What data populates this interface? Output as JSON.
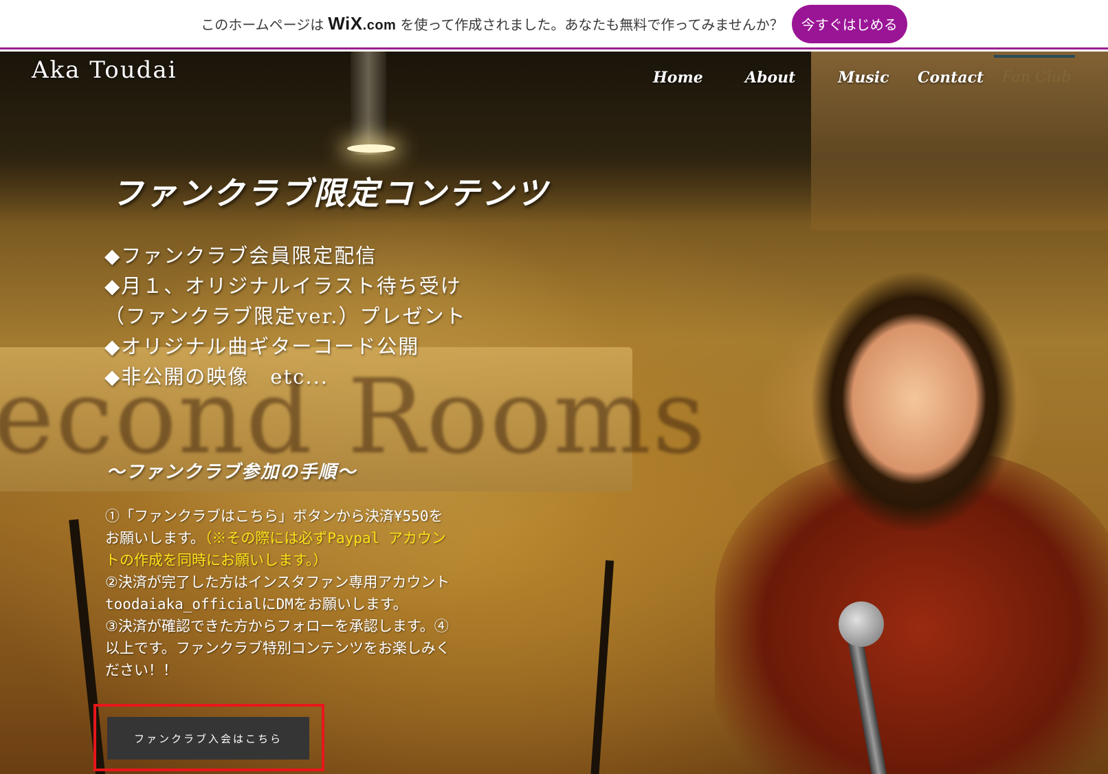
{
  "wix_banner": {
    "text_before": "このホームページは",
    "logo": "WiX",
    "logo_suffix": ".com",
    "text_after": "を使って作成されました。あなたも無料で作ってみませんか？",
    "cta_label": "今すぐはじめる",
    "accent_color": "#9a1596"
  },
  "site": {
    "title": "Aka Toudai"
  },
  "nav": {
    "items": [
      {
        "label": "Home"
      },
      {
        "label": "About"
      },
      {
        "label": "Music"
      },
      {
        "label": "Contact"
      },
      {
        "label": "Fan Club",
        "active": true
      }
    ]
  },
  "main": {
    "heading": "ファンクラブ限定コンテンツ",
    "features": [
      "◆ファンクラブ会員限定配信",
      "◆月１、オリジナルイラスト待ち受け",
      "（ファンクラブ限定ver.）プレゼント",
      "◆オリジナル曲ギターコード公開",
      "◆非公開の映像　etc..."
    ],
    "background_sign": "econd Rooms",
    "steps_heading": "～ファンクラブ参加の手順～",
    "steps": {
      "part1": "①「ファンクラブはこちら」ボタンから決済¥550をお願いします。",
      "part1_note": "（※その際には必ずPaypal アカウントの作成を同時にお願いします。）",
      "part2": "②決済が完了した方はインスタファン専用アカウントtoodaiaka_officialにDMをお願いします。",
      "part3": "③決済が確認できた方からフォローを承認します。④以上です。ファンクラブ特別コンテンツをお楽しみください！！"
    },
    "cta_label": "ファンクラブ入会はこちら",
    "note_color": "#ffe21a",
    "highlight_color": "#e8161b"
  }
}
